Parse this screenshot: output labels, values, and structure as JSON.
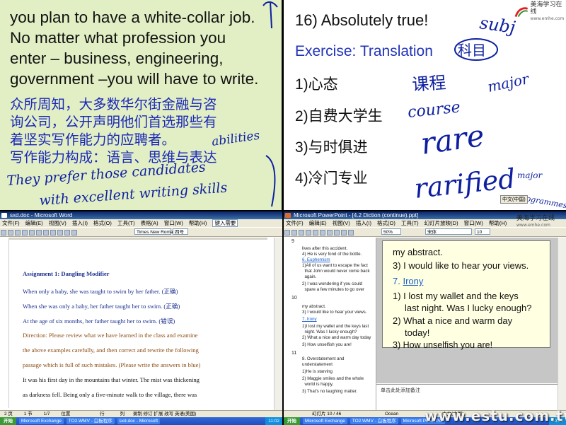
{
  "top_left": {
    "english_lines": [
      "you plan to have a white-collar job.",
      "No matter what profession you",
      "enter – business, engineering,",
      "government –you will have to write."
    ],
    "chinese_lines": [
      "众所周知，大多数华尔街金融与咨",
      "询公司，公开声明他们首选那些有",
      "着坚实写作能力的应聘者。",
      "写作能力构成：语言、思维与表达"
    ],
    "handwriting": [
      "abilities",
      "They prefer those candidates",
      "with excellent writing skills"
    ]
  },
  "logo": {
    "name": "美海学习在线",
    "url": "www.emhe.com"
  },
  "top_right": {
    "heading": "16) Absolutely true!",
    "exercise_title": "Exercise: Translation",
    "items": [
      "1)心态",
      "2)自费大学生",
      "3)与时俱进",
      "4)冷门专业"
    ],
    "handwriting": [
      "subj",
      "科目",
      "课程",
      "major",
      "course",
      "rare",
      "rarified",
      "major",
      "programmes"
    ],
    "ime": "中文(中国)"
  },
  "word_window": {
    "title": "sxd.doc - Microsoft Word",
    "menu": [
      "文件(F)",
      "编辑(E)",
      "视图(V)",
      "插入(I)",
      "格式(O)",
      "工具(T)",
      "表格(A)",
      "窗口(W)",
      "帮助(H)"
    ],
    "help_box": "键入需要",
    "font_name": "Times New Roman",
    "font_size": "四号",
    "doc_lines": [
      {
        "text": "Assignment 1: Dangling Modifier",
        "color": "#1a2f8f",
        "bold": true
      },
      {
        "text": "When only a baby, she was taught to swim by her father. (正确)",
        "color": "#1a2f8f",
        "bold": false
      },
      {
        "text": "When she was only a baby, her father taught her to swim. (正确)",
        "color": "#1a2f8f",
        "bold": false
      },
      {
        "text": "At the age of six months, her father taught her to swim.  (错误)",
        "color": "#1a2f8f",
        "bold": false
      },
      {
        "text": "Direction: Please review what we have learned in the class and examine",
        "color": "#8b4a12",
        "bold": false
      },
      {
        "text": "the above examples carefully, and then correct and rewrite the following",
        "color": "#8b4a12",
        "bold": false
      },
      {
        "text": "passage which is full of such mistakes. (Please write the answers in blue)",
        "color": "#8b4a12",
        "bold": false
      },
      {
        "text": "It was his first day in the mountains that winter. The mist was thickening",
        "color": "#111111",
        "bold": false
      },
      {
        "text": "as darkness fell. Being only a five-minute walk to the village, there was",
        "color": "#111111",
        "bold": false
      }
    ],
    "status": [
      "2 页",
      "1 节",
      "1/7",
      "位置",
      "行",
      "列",
      "录制",
      "修订",
      "扩展",
      "改写",
      "英语(美国)"
    ]
  },
  "ppt_window": {
    "title": "Microsoft PowerPoint - [4.2 Diction (continue).ppt]",
    "menu": [
      "文件(F)",
      "编辑(E)",
      "视图(V)",
      "插入(I)",
      "格式(O)",
      "工具(T)",
      "幻灯片放映(D)",
      "窗口(W)",
      "帮助(H)"
    ],
    "zoom": "50%",
    "font_name": "宋体",
    "font_size": "10",
    "outline": [
      {
        "num": "9",
        "lines": [
          "lives after this accident.",
          "4) He is very fond of the bottle.",
          "6. Euphemism",
          "1)All of us want to escape the fact",
          "  that John would never come back",
          "  again.",
          "2) I was wondering if you could",
          "  spare a few minutes to go over"
        ]
      },
      {
        "num": "10",
        "lines": [
          "my abstract.",
          "3) I would like to hear your views.",
          "7. Irony",
          "1)I lost my wallet and the keys last",
          "  night. Was I lucky enough?",
          "2) What a nice and warm day today",
          "3) How unselfish you are!"
        ]
      },
      {
        "num": "11",
        "lines": [
          "8. Overstatement and",
          "understatement",
          "1)He is starving",
          "2) Maggie smiles and the whole",
          "  world is happy.",
          "3) That's no laughing matter."
        ]
      }
    ],
    "slide": {
      "line1": "my abstract.",
      "line2": "3) I would like to hear your views.",
      "heading_num": "7.",
      "heading": "Irony",
      "item1a": "1) I lost my wallet and the keys",
      "item1b": "last night. Was I lucky enough?",
      "item2a": "2) What a nice and warm day",
      "item2b": "today!",
      "item3": "3) How unselfish you are!"
    },
    "notes": "单击此处添加备注",
    "status": [
      "幻灯片 10 / 46",
      "Ocean",
      "中文(中国)"
    ]
  },
  "taskbar_left": {
    "start": "开始",
    "tasks": [
      "Microsoft Exchange",
      "TO2.WMV - 白板程序",
      "sxd.doc - Microsoft"
    ],
    "clock": "11:02"
  },
  "taskbar_right": {
    "start": "开始",
    "tasks": [
      "Microsoft Exchange",
      "TO2.WMV - 白板程序",
      "Microsoft PowerPoi"
    ],
    "clock": "10:58"
  },
  "watermark": "www.estu.com.tw",
  "colors": {
    "slide_left_bg": "#e2efc5",
    "cn_blue": "#1a28b8",
    "ink_blue": "#0d1fa0",
    "link_blue": "#1a5fd0"
  }
}
